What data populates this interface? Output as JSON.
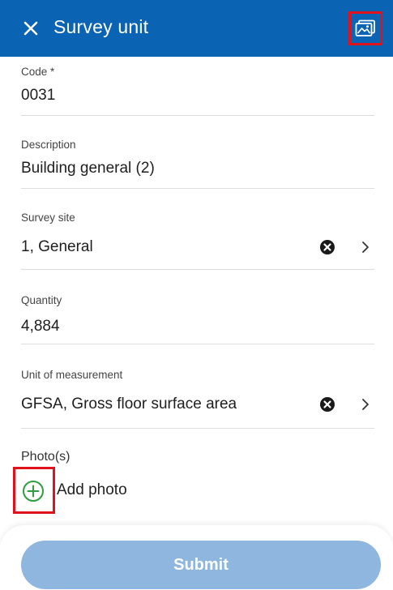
{
  "header": {
    "title": "Survey unit",
    "close_icon": "close-icon",
    "photo_icon": "image-icon",
    "background": "#0b63b3"
  },
  "fields": {
    "code": {
      "label": "Code *",
      "value": "0031"
    },
    "description": {
      "label": "Description",
      "value": "Building general (2)"
    },
    "survey_site": {
      "label": "Survey site",
      "value": "1, General"
    },
    "quantity": {
      "label": "Quantity",
      "value": "4,884"
    },
    "unit": {
      "label": "Unit of measurement",
      "value": "GFSA, Gross floor surface area"
    }
  },
  "photos": {
    "label": "Photo(s)",
    "add_label": "Add photo",
    "add_icon_color": "#2e9e3f"
  },
  "footer": {
    "submit_label": "Submit",
    "submit_color": "#8fb6de"
  },
  "highlight_color": "#e0121b"
}
